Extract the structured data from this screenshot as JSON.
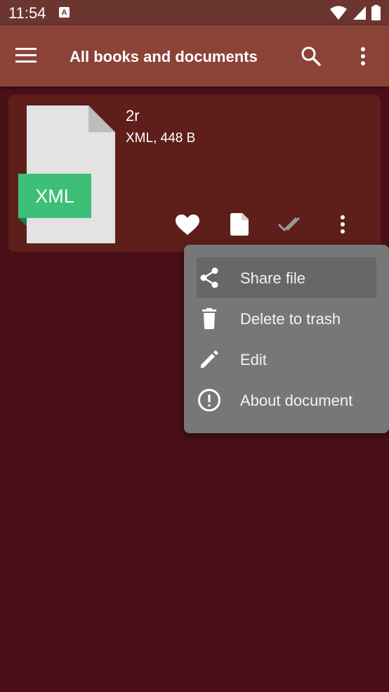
{
  "status_bar": {
    "time": "11:54",
    "notification_icon": "a-letter-icon",
    "right_icons": [
      "wifi-icon",
      "signal-icon",
      "battery-icon"
    ]
  },
  "app_bar": {
    "title": "All books and documents",
    "icons": [
      "menu-icon",
      "search-icon",
      "more-vert-icon"
    ]
  },
  "book": {
    "thumbnail_label": "XML",
    "name": "2r",
    "meta": "XML, 448 B",
    "actions": [
      "favorite-icon",
      "document-icon",
      "done-all-icon",
      "more-vert-icon"
    ]
  },
  "context_menu": {
    "items": [
      {
        "label": "Share file",
        "icon": "share-icon",
        "highlighted": true
      },
      {
        "label": "Delete to trash",
        "icon": "trash-icon"
      },
      {
        "label": "Edit",
        "icon": "pencil-icon"
      },
      {
        "label": "About document",
        "icon": "info-icon"
      }
    ]
  },
  "colors": {
    "status_bar": "#6b3530",
    "app_bar": "#8b4338",
    "background": "#4a1017",
    "card": "#5e1f1a",
    "menu": "#777777",
    "menu_highlight": "#676767",
    "xml_badge": "#3dbf78"
  }
}
